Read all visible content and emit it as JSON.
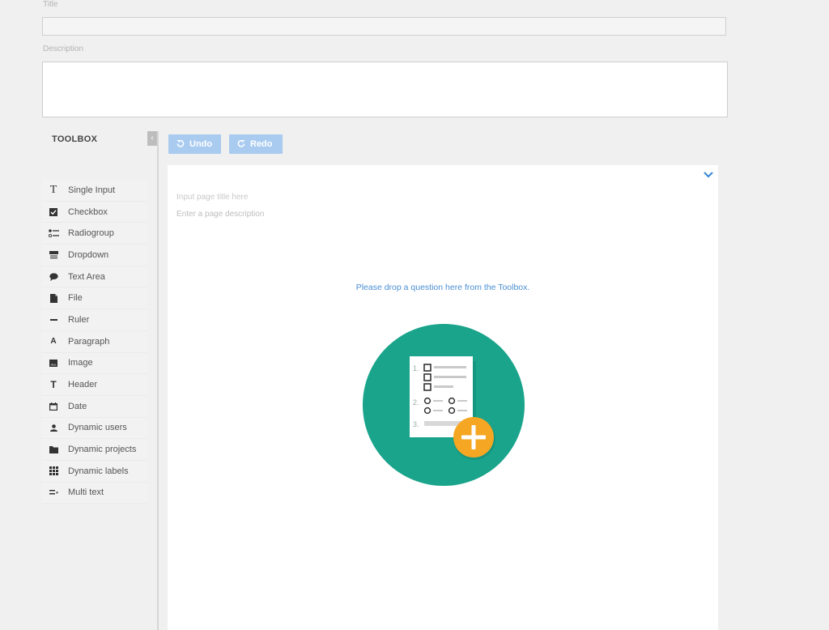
{
  "form": {
    "title_label": "Title",
    "title_value": "",
    "description_label": "Description",
    "description_value": ""
  },
  "toolbox": {
    "title": "TOOLBOX",
    "collapse_icon": "collapse-left-icon",
    "items": [
      {
        "label": "Single Input",
        "icon": "text-icon"
      },
      {
        "label": "Checkbox",
        "icon": "checkbox-icon"
      },
      {
        "label": "Radiogroup",
        "icon": "radiogroup-icon"
      },
      {
        "label": "Dropdown",
        "icon": "dropdown-icon"
      },
      {
        "label": "Text Area",
        "icon": "comment-icon"
      },
      {
        "label": "File",
        "icon": "file-icon"
      },
      {
        "label": "Ruler",
        "icon": "ruler-icon"
      },
      {
        "label": "Paragraph",
        "icon": "paragraph-icon"
      },
      {
        "label": "Image",
        "icon": "image-icon"
      },
      {
        "label": "Header",
        "icon": "header-icon"
      },
      {
        "label": "Date",
        "icon": "calendar-icon"
      },
      {
        "label": "Dynamic users",
        "icon": "user-icon"
      },
      {
        "label": "Dynamic projects",
        "icon": "folder-icon"
      },
      {
        "label": "Dynamic labels",
        "icon": "grid-icon"
      },
      {
        "label": "Multi text",
        "icon": "multi-text-icon"
      }
    ]
  },
  "toolbar": {
    "undo_label": "Undo",
    "redo_label": "Redo"
  },
  "designer": {
    "page_title_placeholder": "Input page title here",
    "page_description_placeholder": "Enter a page description",
    "drop_message": "Please drop a question here from the Toolbox.",
    "illustration_numbers": [
      "1.",
      "2.",
      "3."
    ]
  },
  "colors": {
    "accent": "#a9cbf0",
    "link": "#4a8ed3",
    "teal": "#19a48b",
    "orange": "#f5a623"
  }
}
